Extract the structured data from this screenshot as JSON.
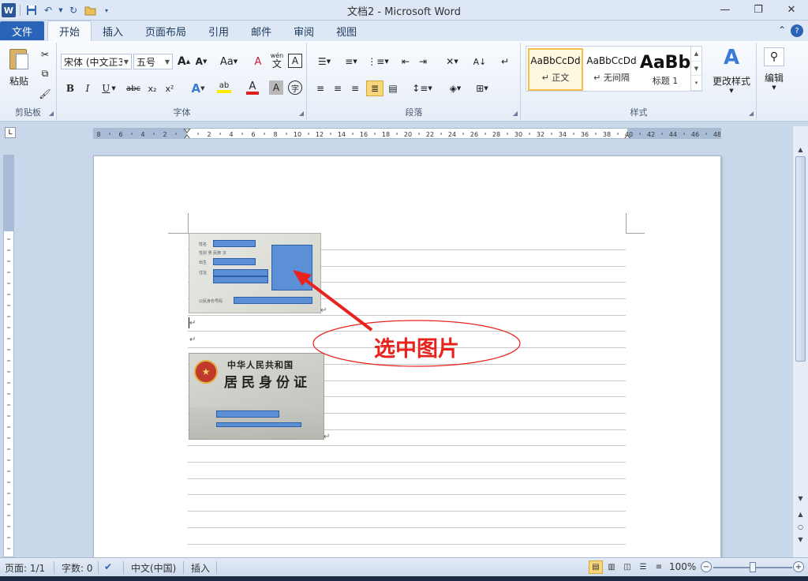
{
  "window": {
    "title": "文档2 - Microsoft Word",
    "app_logo": "W",
    "qat_icons": [
      "save-icon",
      "undo-icon",
      "redo-icon",
      "open-folder-icon",
      "customize-icon"
    ]
  },
  "ribbon": {
    "file_tab": "文件",
    "tabs": [
      "开始",
      "插入",
      "页面布局",
      "引用",
      "邮件",
      "审阅",
      "视图"
    ],
    "active_tab": "开始",
    "clipboard": {
      "group_label": "剪贴板",
      "paste_label": "粘贴"
    },
    "font": {
      "group_label": "字体",
      "font_name": "宋体 (中文正3",
      "font_size": "五号",
      "grow": "A",
      "shrink": "A",
      "change_case": "Aa",
      "clear": "A",
      "bold": "B",
      "italic": "I",
      "underline": "U",
      "strike": "abc",
      "subscript": "x₂",
      "superscript": "x²",
      "highlight": "ab",
      "font_color": "A",
      "char_shade": "A",
      "enclose": "字",
      "phonetic_top": "wén",
      "phonetic_bottom": "文"
    },
    "paragraph": {
      "group_label": "段落"
    },
    "styles": {
      "group_label": "样式",
      "items": [
        {
          "sample": "AaBbCcDd",
          "name": "↵ 正文"
        },
        {
          "sample": "AaBbCcDd",
          "name": "↵ 无间隔"
        },
        {
          "sample": "AaBb",
          "name": "标题 1"
        }
      ],
      "change_styles": "更改样式"
    },
    "editing": {
      "label": "编辑"
    }
  },
  "ruler": {
    "ticks": [
      "8",
      "6",
      "4",
      "2",
      "",
      "2",
      "4",
      "6",
      "8",
      "10",
      "12",
      "14",
      "16",
      "18",
      "20",
      "22",
      "24",
      "26",
      "28",
      "30",
      "32",
      "34",
      "36",
      "38",
      "40",
      "42",
      "44",
      "46",
      "48"
    ]
  },
  "document": {
    "annotation_text": "选中图片",
    "id_front_line1": "中华人民共和国",
    "id_front_line2": "居民身份证",
    "id_back_labels": [
      "姓名",
      "性别   男   民族 汉",
      "出生",
      "住址",
      "公民身份号码"
    ],
    "paragraph_mark": "↵"
  },
  "statusbar": {
    "page": "页面: 1/1",
    "words": "字数: 0",
    "language": "中文(中国)",
    "mode": "插入",
    "zoom": "100%",
    "zoom_minus": "−",
    "zoom_plus": "+"
  },
  "colors": {
    "accent": "#2a64b8",
    "annotation": "#e8221c",
    "id_field": "#5b8fd6"
  }
}
